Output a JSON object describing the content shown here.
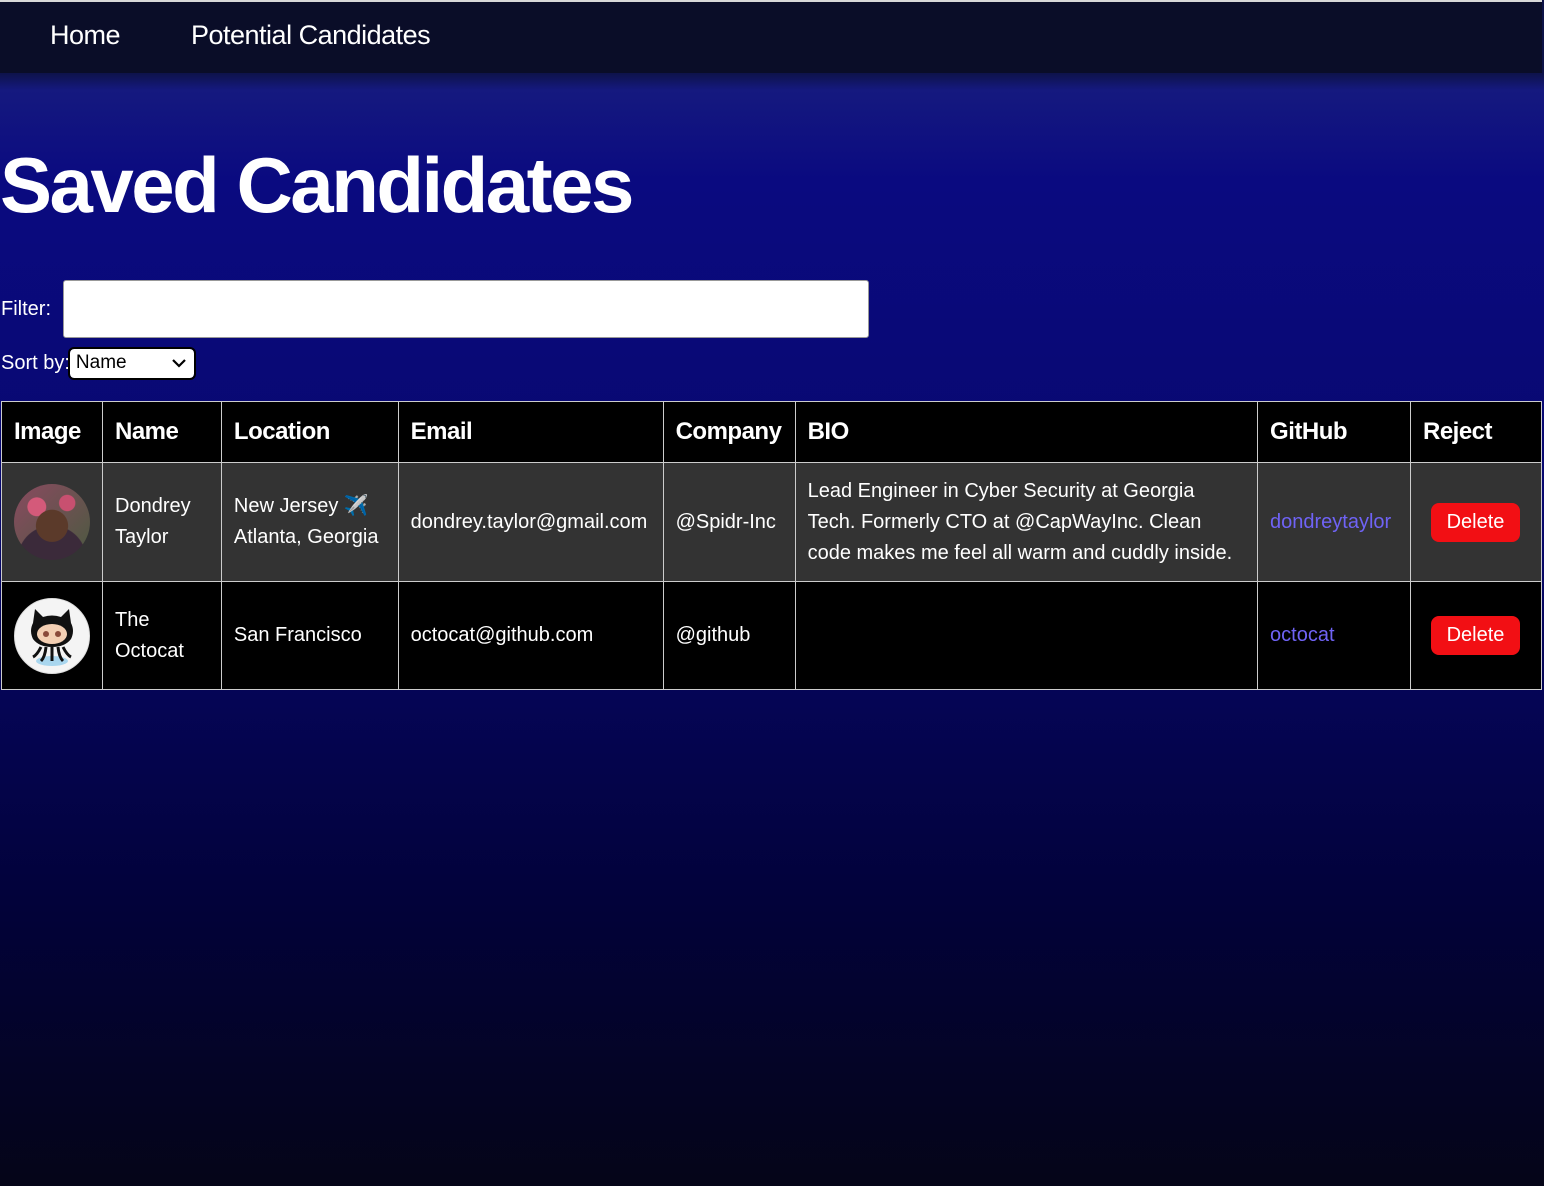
{
  "nav": {
    "home_label": "Home",
    "potential_label": "Potential Candidates"
  },
  "page": {
    "title": "Saved Candidates"
  },
  "filter": {
    "label": "Filter:",
    "value": "",
    "placeholder": ""
  },
  "sort": {
    "label": "Sort by:",
    "selected": "Name"
  },
  "table": {
    "headers": [
      "Image",
      "Name",
      "Location",
      "Email",
      "Company",
      "BIO",
      "GitHub",
      "Reject"
    ],
    "rows": [
      {
        "name": "Dondrey Taylor",
        "location": "New Jersey ✈️ Atlanta, Georgia",
        "email": "dondrey.taylor@gmail.com",
        "company": "@Spidr-Inc",
        "bio": "Lead Engineer in Cyber Security at Georgia Tech. Formerly CTO at @CapWayInc. Clean code makes me feel all warm and cuddly inside.",
        "github": "dondreytaylor",
        "reject_label": "Delete"
      },
      {
        "name": "The Octocat",
        "location": "San Francisco",
        "email": "octocat@github.com",
        "company": "@github",
        "bio": "",
        "github": "octocat",
        "reject_label": "Delete"
      }
    ]
  },
  "colors": {
    "delete_button": "#f20f14",
    "link": "#6f63f5",
    "nav_bg": "#0a0d28"
  }
}
